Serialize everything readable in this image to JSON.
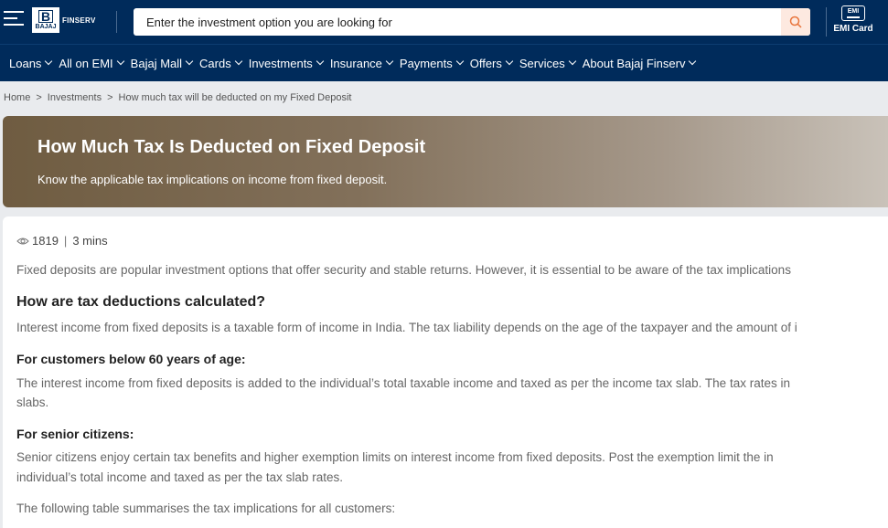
{
  "header": {
    "logo_text": "FINSERV",
    "logo_box_text": "BAJAJ",
    "search_placeholder": "Enter the investment option you are looking for",
    "emi_icon_text": "EMI",
    "emi_card_label": "EMI Card"
  },
  "nav": {
    "items": [
      "Loans",
      "All on EMI",
      "Bajaj Mall",
      "Cards",
      "Investments",
      "Insurance",
      "Payments",
      "Offers",
      "Services",
      "About Bajaj Finserv"
    ]
  },
  "breadcrumb": {
    "home": "Home",
    "investments": "Investments",
    "current": "How much tax will be deducted on my Fixed Deposit"
  },
  "hero": {
    "title": "How Much Tax Is Deducted on Fixed Deposit",
    "subtitle": "Know the applicable tax implications on income from fixed deposit."
  },
  "article": {
    "views": "1819",
    "read_time": "3 mins",
    "intro": "Fixed deposits are popular investment options that offer security and stable returns. However, it is essential to be aware of the tax implications",
    "h_calc": "How are tax deductions calculated?",
    "p_calc": "Interest income from fixed deposits is a taxable form of income in India. The tax liability depends on the age of the taxpayer and the amount of i",
    "h_below60": "For customers below 60 years of age:",
    "p_below60_line1": "The interest income from fixed deposits is added to the individual’s total taxable income and taxed as per the income tax slab. The tax rates in",
    "p_below60_line2": "slabs.",
    "h_senior": "For senior citizens:",
    "p_senior_line1": "Senior citizens enjoy certain tax benefits and higher exemption limits on interest income from fixed deposits. Post the exemption limit the in",
    "p_senior_line2": "individual’s total income and taxed as per the tax slab rates.",
    "p_table": "The following table summarises the tax implications for all customers:"
  },
  "colors": {
    "header_bg": "#002b5b",
    "search_btn_bg": "#fde9e0",
    "search_icon": "#e8743b"
  }
}
